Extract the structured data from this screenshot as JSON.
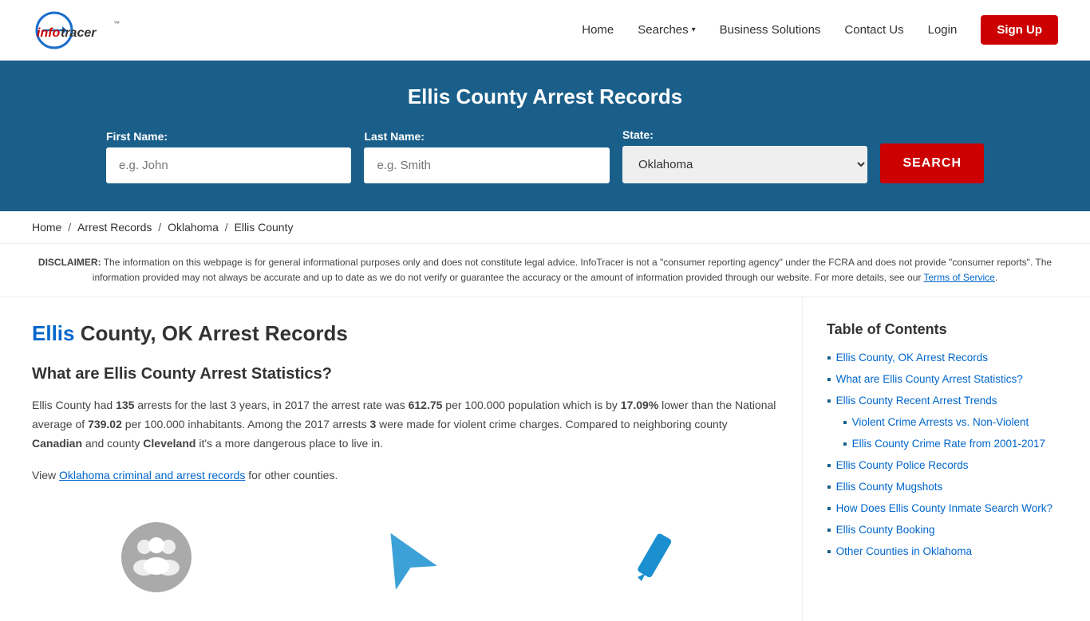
{
  "header": {
    "logo_alt": "InfoTracer",
    "nav": {
      "home": "Home",
      "searches": "Searches",
      "business_solutions": "Business Solutions",
      "contact_us": "Contact Us",
      "login": "Login",
      "signup": "Sign Up"
    }
  },
  "hero": {
    "title": "Ellis County Arrest Records",
    "form": {
      "first_name_label": "First Name:",
      "first_name_placeholder": "e.g. John",
      "last_name_label": "Last Name:",
      "last_name_placeholder": "e.g. Smith",
      "state_label": "State:",
      "state_value": "Oklahoma",
      "search_button": "SEARCH"
    }
  },
  "breadcrumb": {
    "home": "Home",
    "arrest_records": "Arrest Records",
    "oklahoma": "Oklahoma",
    "ellis_county": "Ellis County"
  },
  "disclaimer": {
    "label": "DISCLAIMER:",
    "text": "The information on this webpage is for general informational purposes only and does not constitute legal advice. InfoTracer is not a \"consumer reporting agency\" under the FCRA and does not provide \"consumer reports\". The information provided may not always be accurate and up to date as we do not verify or guarantee the accuracy or the amount of information provided through our website. For more details, see our",
    "link_text": "Terms of Service",
    "link_end": "."
  },
  "main": {
    "heading_blue": "Ellis",
    "heading_rest": " County, OK Arrest Records",
    "stats_heading": "What are Ellis County Arrest Statistics?",
    "stats_text1": "Ellis County had ",
    "arrests": "135",
    "stats_text2": " arrests for the last 3 years, in 2017 the arrest rate was ",
    "rate": "612.75",
    "stats_text3": " per 100.000 population which is by ",
    "lower_pct": "17.09%",
    "stats_text4": " lower than the National average of ",
    "national_avg": "739.02",
    "stats_text5": " per 100.000 inhabitants. Among the 2017 arrests ",
    "violent_count": "3",
    "stats_text6": " were made for violent crime charges. Compared to neighboring county ",
    "county1": "Canadian",
    "stats_text7": " and county ",
    "county2": "Cleveland",
    "stats_text8": " it's a more dangerous place to live in.",
    "view_text": "View ",
    "view_link": "Oklahoma criminal and arrest records",
    "view_text2": " for other counties."
  },
  "toc": {
    "title": "Table of Contents",
    "items": [
      {
        "text": "Ellis County, OK Arrest Records",
        "sub": false
      },
      {
        "text": "What are Ellis County Arrest Statistics?",
        "sub": false
      },
      {
        "text": "Ellis County Recent Arrest Trends",
        "sub": false
      },
      {
        "text": "Violent Crime Arrests vs. Non-Violent",
        "sub": true
      },
      {
        "text": "Ellis County Crime Rate from 2001-2017",
        "sub": true
      },
      {
        "text": "Ellis County Police Records",
        "sub": false
      },
      {
        "text": "Ellis County Mugshots",
        "sub": false
      },
      {
        "text": "How Does Ellis County Inmate Search Work?",
        "sub": false
      },
      {
        "text": "Ellis County Booking",
        "sub": false
      },
      {
        "text": "Other Counties in Oklahoma",
        "sub": false
      }
    ]
  },
  "colors": {
    "hero_bg": "#1a5f8a",
    "red": "#cc0000",
    "blue": "#0066cc",
    "dark_blue": "#1a5f8a"
  }
}
